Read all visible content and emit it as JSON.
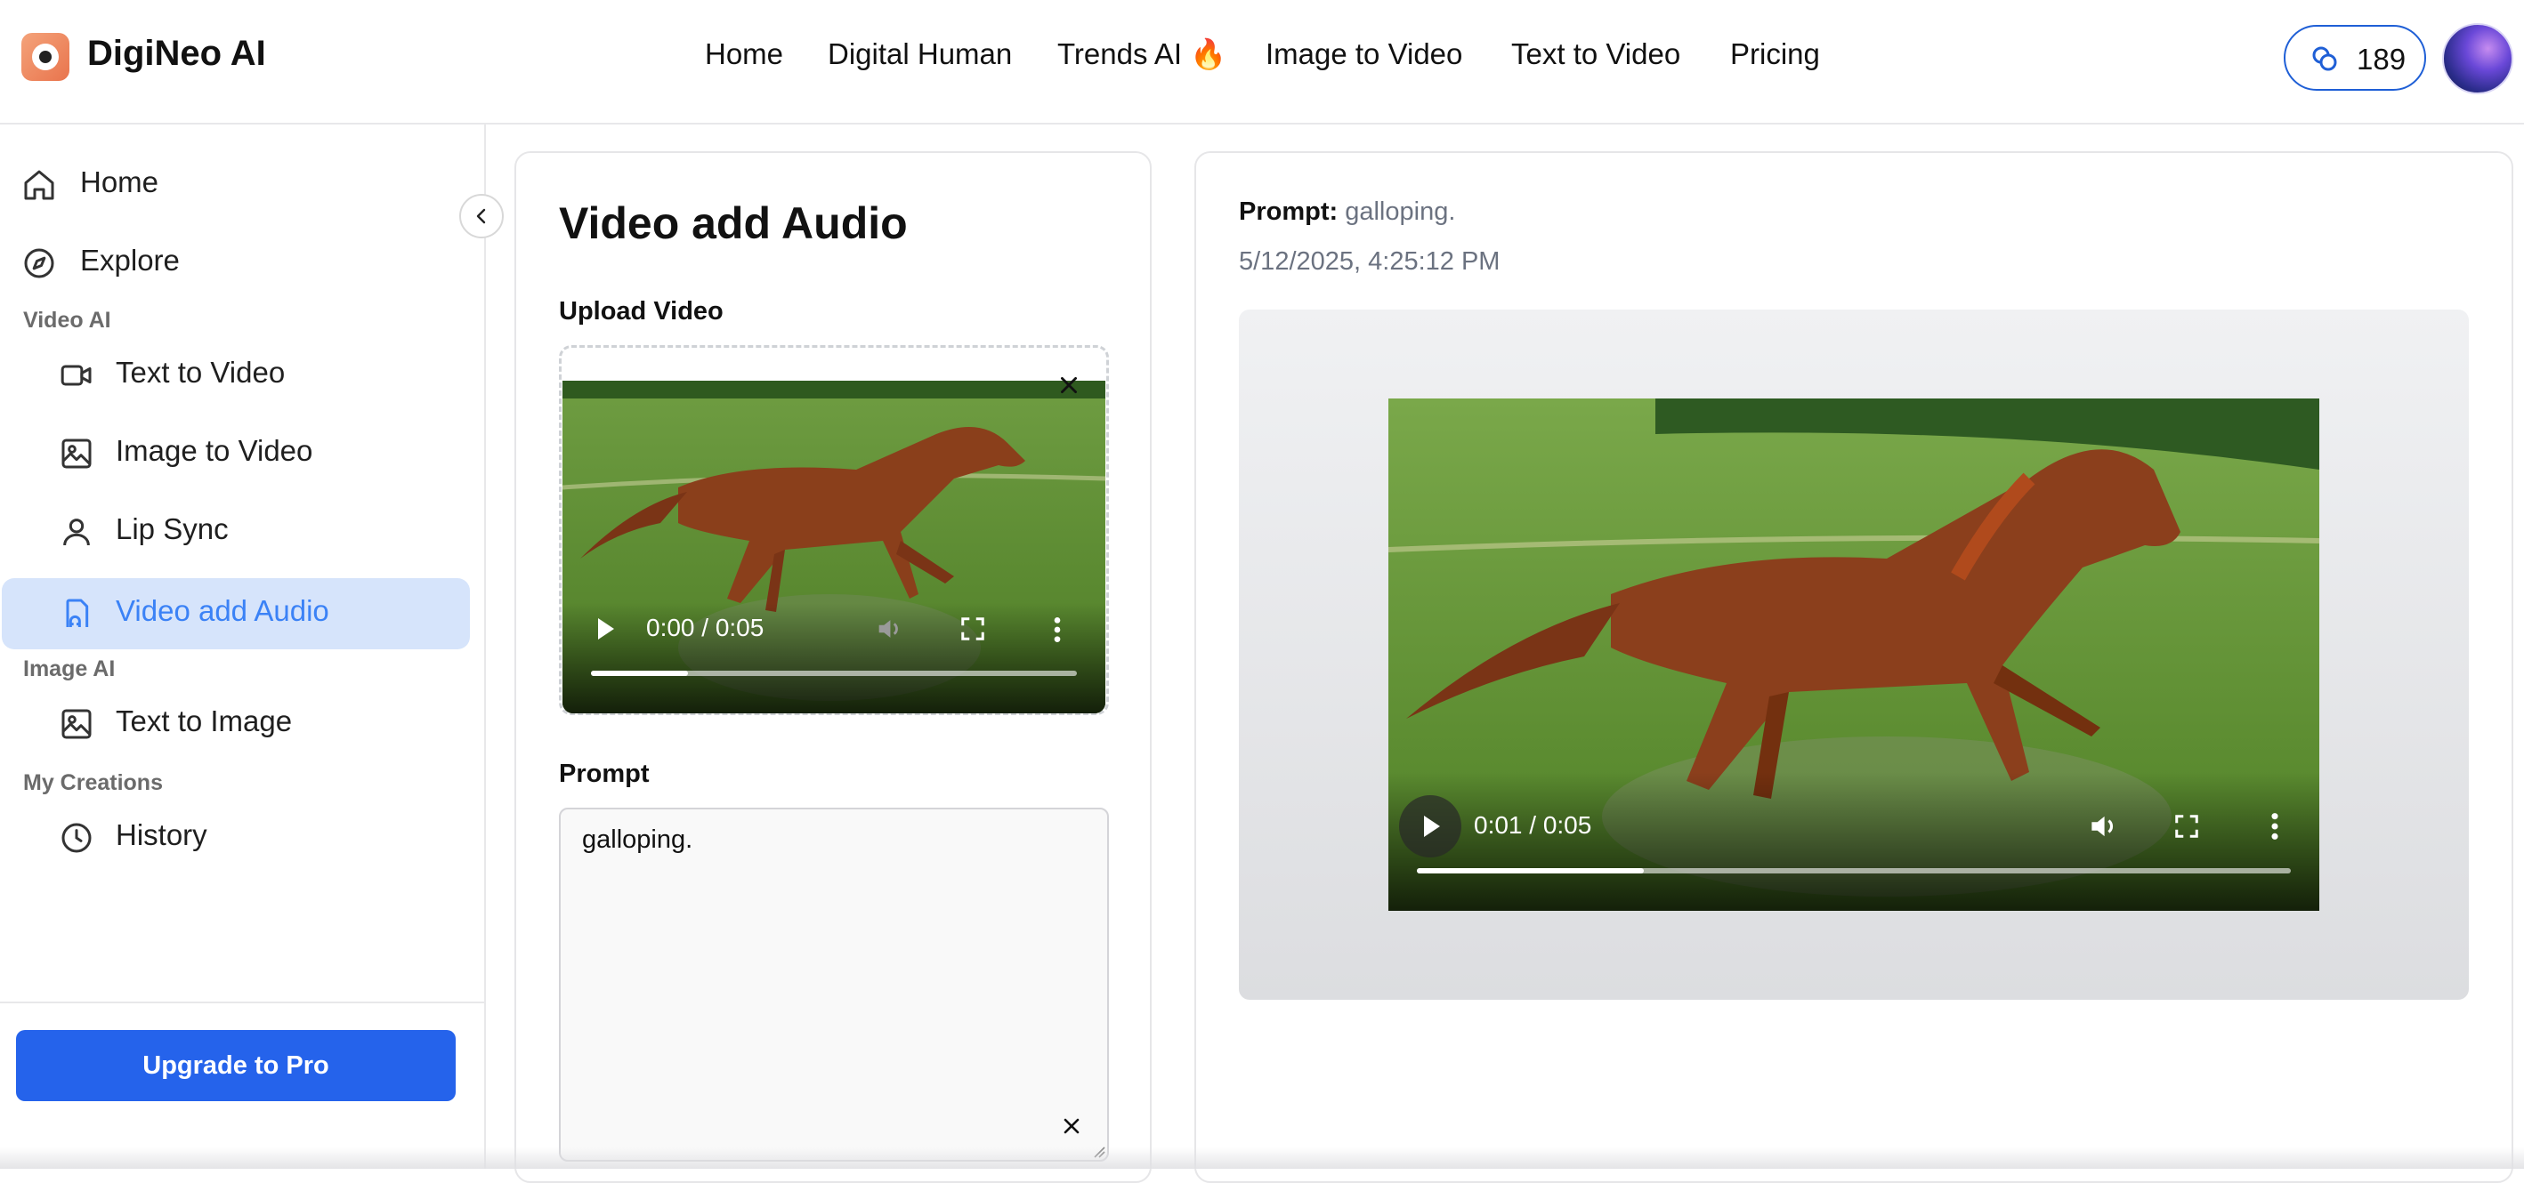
{
  "header": {
    "brand": "DigiNeo AI",
    "nav": [
      "Home",
      "Digital Human",
      "Trends AI 🔥",
      "Image to Video",
      "Text to Video",
      "Pricing"
    ],
    "credits": "189"
  },
  "sidebar": {
    "items": [
      {
        "label": "Home",
        "icon": "home-icon"
      },
      {
        "label": "Explore",
        "icon": "compass-icon"
      }
    ],
    "sections": [
      {
        "label": "Video AI",
        "items": [
          {
            "label": "Text to Video",
            "icon": "video-camera-icon"
          },
          {
            "label": "Image to Video",
            "icon": "image-icon"
          },
          {
            "label": "Lip Sync",
            "icon": "user-icon"
          },
          {
            "label": "Video add Audio",
            "icon": "audio-file-icon",
            "active": true
          }
        ]
      },
      {
        "label": "Image AI",
        "items": [
          {
            "label": "Text to Image",
            "icon": "image-icon"
          }
        ]
      },
      {
        "label": "My Creations",
        "items": [
          {
            "label": "History",
            "icon": "clock-icon"
          }
        ]
      }
    ],
    "upgrade_label": "Upgrade to Pro"
  },
  "form": {
    "title": "Video add Audio",
    "upload_label": "Upload Video",
    "upload_video": {
      "time": "0:00 / 0:05",
      "progress": 0.2
    },
    "prompt_label": "Prompt",
    "prompt_value": "galloping."
  },
  "result": {
    "prompt_key": "Prompt:",
    "prompt_value": "galloping.",
    "timestamp": "5/12/2025, 4:25:12 PM",
    "video": {
      "time": "0:01 / 0:05",
      "progress": 0.26
    }
  },
  "colors": {
    "accent": "#2563eb",
    "active_bg": "#d6e4fb",
    "active_text": "#3b82f6"
  }
}
